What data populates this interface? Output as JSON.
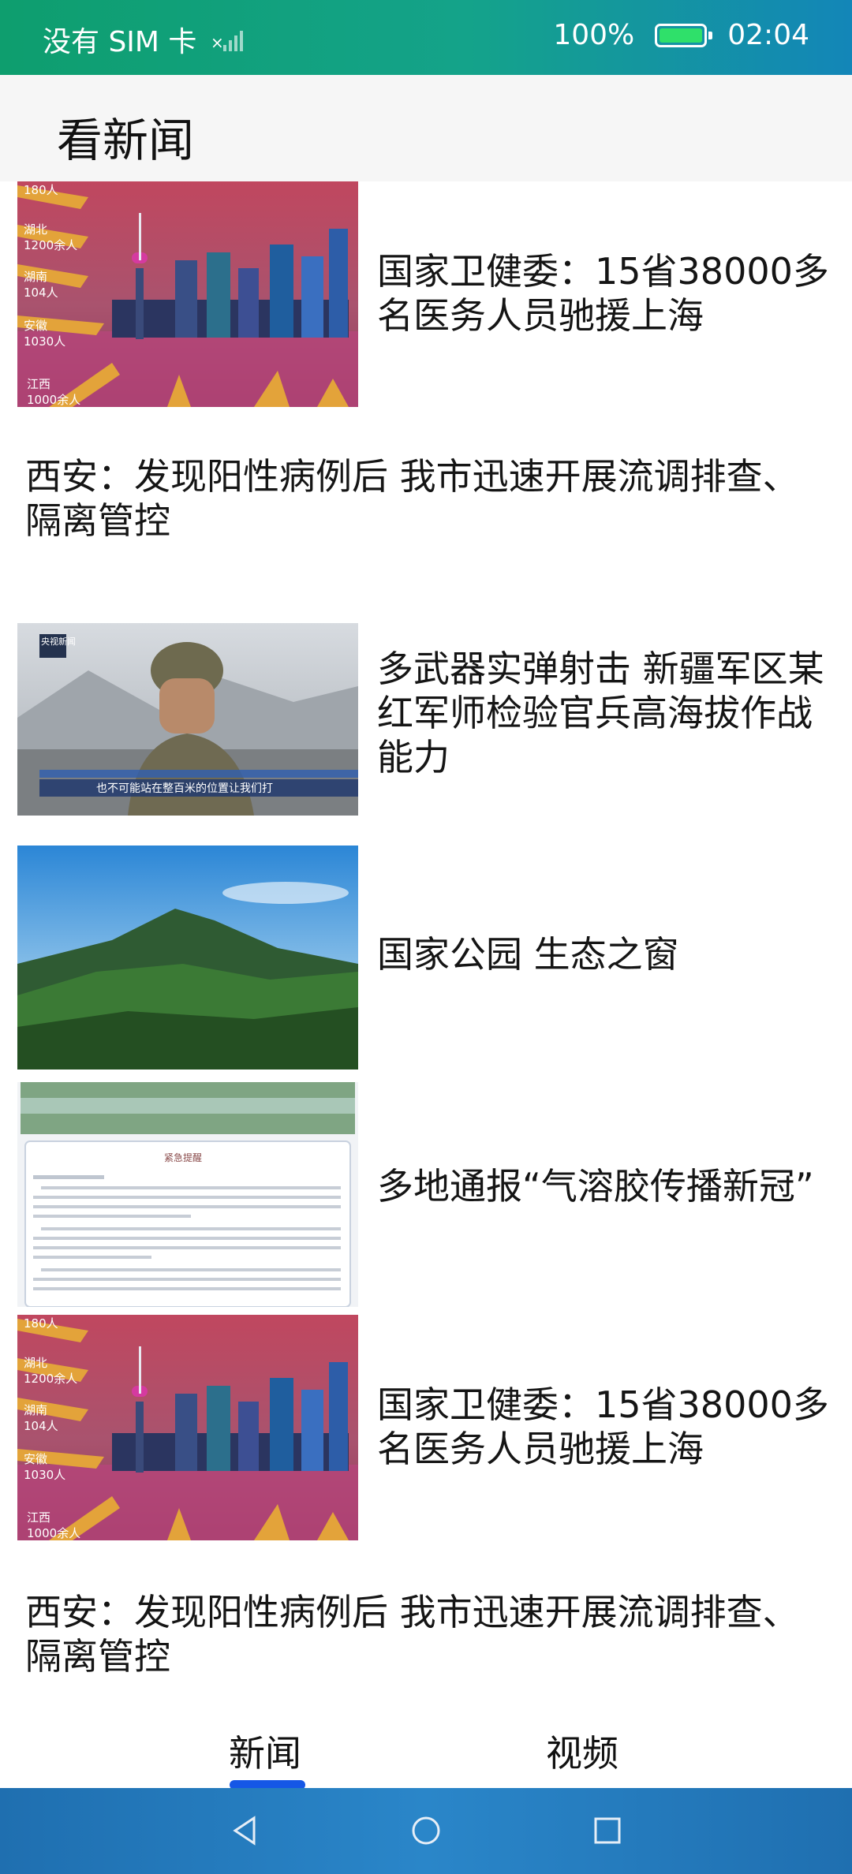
{
  "status": {
    "carrier": "没有 SIM 卡",
    "battery": "100%",
    "time": "02:04",
    "battery_level": 1.0
  },
  "header": {
    "title": "看新闻"
  },
  "news": [
    {
      "title": "国家卫健委：15省38000多名医务人员驰援上海",
      "thumb_labels": [
        "180人",
        "湖北",
        "1200余人",
        "湖南",
        "104人",
        "安徽",
        "1030人",
        "江西",
        "1000余人"
      ]
    },
    {
      "title": "西安：发现阳性病例后 我市迅速开展流调排查、隔离管控"
    },
    {
      "title": "多武器实弹射击 新疆军区某红军师检验官兵高海拔作战能力",
      "thumb_badge": "央视新闻",
      "thumb_caption": "也不可能站在整百米的位置让我们打"
    },
    {
      "title": "国家公园 生态之窗"
    },
    {
      "title": "多地通报“气溶胶传播新冠”",
      "thumb_doc_title": "紧急提醒"
    },
    {
      "title": "国家卫健委：15省38000多名医务人员驰援上海",
      "thumb_labels": [
        "180人",
        "湖北",
        "1200余人",
        "湖南",
        "104人",
        "安徽",
        "1030人",
        "江西",
        "1000余人"
      ]
    },
    {
      "title": "西安：发现阳性病例后 我市迅速开展流调排查、隔离管控"
    }
  ],
  "tabs": [
    {
      "label": "新闻",
      "active": true
    },
    {
      "label": "视频",
      "active": false
    }
  ]
}
